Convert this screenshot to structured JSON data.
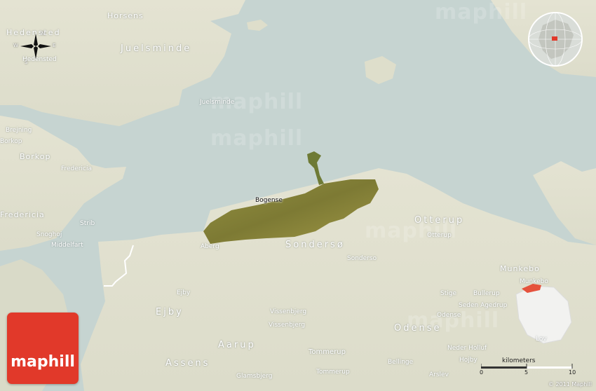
{
  "labels": {
    "horsens": "Horsens",
    "hedensted_region": "Hedensted",
    "hedensted": "Hedensted",
    "juelsminde_region": "Juelsminde",
    "juelsminde": "Juelsminde",
    "brejning": "Brejning",
    "borkop": "Borkop",
    "borkop_region": "Borkop",
    "fredericia": "Fredericia",
    "fredericia_region": "Fredericia",
    "strib": "Strib",
    "snoghoj": "Snoghoj",
    "middelfart": "Middelfart",
    "bogense": "Bogense",
    "aberg": "Aberg",
    "sondersø_region": "Sondersø",
    "sonderso": "Sonderso",
    "otterup_region": "Otterup",
    "otterup": "Otterup",
    "munkebo_region": "Munkebo",
    "munkebo": "Munkebo",
    "bullerup": "Bullerup",
    "stige": "Stige",
    "seden": "Seden Agedrup",
    "odense_region": "Odense",
    "odense": "Odense",
    "ejby": "Ejby",
    "ejby_region": "Ejby",
    "vissenbjerg_region": "Vissenbjerg",
    "vissenbjerg": "Vissenbjerg",
    "aarup_region": "Aarup",
    "assens_region": "Assens",
    "tommerup_region": "Tommerup",
    "tommerup": "Tommerup",
    "glamsbjerg": "Glamsbjerg",
    "bellinge": "Bellinge",
    "neder_holluf": "Neder Holluf",
    "hojby": "Hojby",
    "arslev": "Arslev",
    "lov": "Lov"
  },
  "compass": {
    "n": "N",
    "s": "S",
    "e": "E",
    "w": "W"
  },
  "watermark": "maphill",
  "logo": "maphill",
  "scale": {
    "title": "kilometers",
    "ticks": [
      "0",
      "5",
      "10"
    ]
  },
  "copyright": "© 2011 Maphill",
  "colors": {
    "land": "#e3e2d0",
    "water": "#c7d5d2",
    "highlight": "#8b8a3c",
    "logo": "#e1392a",
    "inset_marker": "#e5523d"
  }
}
